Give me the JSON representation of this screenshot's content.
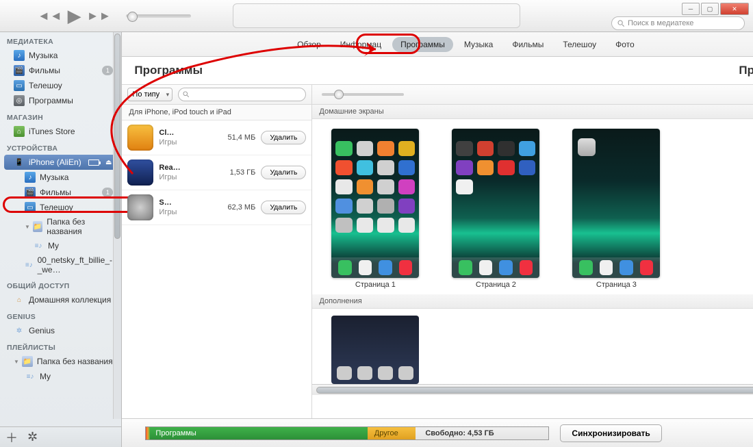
{
  "search_placeholder": "Поиск в медиатеке",
  "sidebar": {
    "groups": {
      "library": "МЕДИАТЕКА",
      "store": "МАГАЗИН",
      "devices": "УСТРОЙСТВА",
      "shared": "ОБЩИЙ ДОСТУП",
      "genius": "GENIUS",
      "playlists": "ПЛЕЙЛИСТЫ"
    },
    "library": {
      "music": "Музыка",
      "movies": "Фильмы",
      "movies_badge": "1",
      "tv": "Телешоу",
      "apps": "Программы"
    },
    "store": {
      "itunes": "iTunes Store"
    },
    "device": {
      "name": "iPhone (AliEn)",
      "music": "Музыка",
      "movies": "Фильмы",
      "movies_badge": "1",
      "tv": "Телешоу",
      "folder": "Папка без названия",
      "pl_my": "My",
      "pl_track": "00_netsky_ft_billie_-_we…"
    },
    "shared": {
      "home": "Домашняя коллекция"
    },
    "genius": {
      "item": "Genius"
    },
    "playlists": {
      "folder": "Папка без названия",
      "pl_my": "My"
    }
  },
  "tabs": {
    "overview": "Обзор",
    "info": "Информац",
    "apps": "Программы",
    "music": "Музыка",
    "movies": "Фильмы",
    "tv": "Телешоу",
    "photos": "Фото"
  },
  "header": {
    "title": "Программы",
    "right": "Программ"
  },
  "filter": {
    "sort": "По типу"
  },
  "apps_group_label": "Для iPhone, iPod touch и iPad",
  "apps": [
    {
      "name": "Cl…",
      "genre": "Игры",
      "size": "51,4 МБ",
      "btn": "Удалить"
    },
    {
      "name": "Rea…",
      "genre": "Игры",
      "size": "1,53 ГБ",
      "btn": "Удалить"
    },
    {
      "name": "S…",
      "genre": "Игры",
      "size": "62,3 МБ",
      "btn": "Удалить"
    }
  ],
  "home_screens": {
    "title": "Домашние экраны",
    "pages": [
      "Страница 1",
      "Страница 2",
      "Страница 3"
    ]
  },
  "extras_title": "Дополнения",
  "capacity": {
    "apps": "Программы",
    "other": "Другое",
    "free": "Свободно: 4,53 ГБ"
  },
  "sync_btn": "Синхронизировать"
}
